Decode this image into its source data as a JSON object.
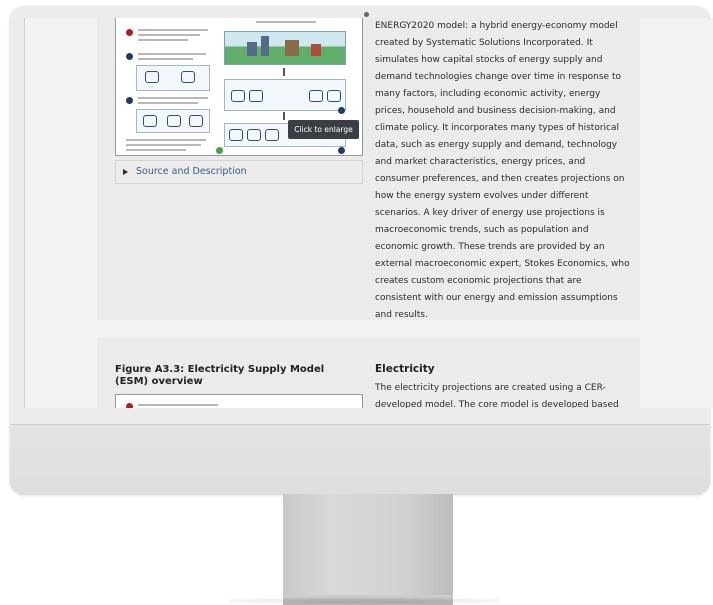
{
  "card1": {
    "paragraph": "ENERGY2020 model: a hybrid energy-economy model created by Systematic Solutions Incorporated. It simulates how capital stocks of energy supply and demand technologies change over time in response to many factors, including economic activity, energy prices, household and business decision-making, and climate policy. It incorporates many types of historical data, such as energy supply and demand, technology and market characteristics, energy prices, and consumer preferences, and then creates projections on how the energy system evolves under different scenarios. A key driver of energy use projections is macroeconomic trends, such as population and economic growth. These trends are provided by an external macroeconomic expert, Stokes Economics, who creates custom economic projections that are consistent with our energy and emission assumptions and results.",
    "tooltip": "Click to enlarge",
    "source_label": "Source and Description"
  },
  "card2": {
    "figure_title": "Figure A3.3: Electricity Supply Model (ESM) overview",
    "section_title": "Electricity",
    "section_text": "The electricity projections are created using a CER-developed model. The core model is developed based"
  },
  "colors": {
    "accent_red": "#b31b1b",
    "accent_navy": "#1f3b66",
    "link": "#3a5a85"
  }
}
